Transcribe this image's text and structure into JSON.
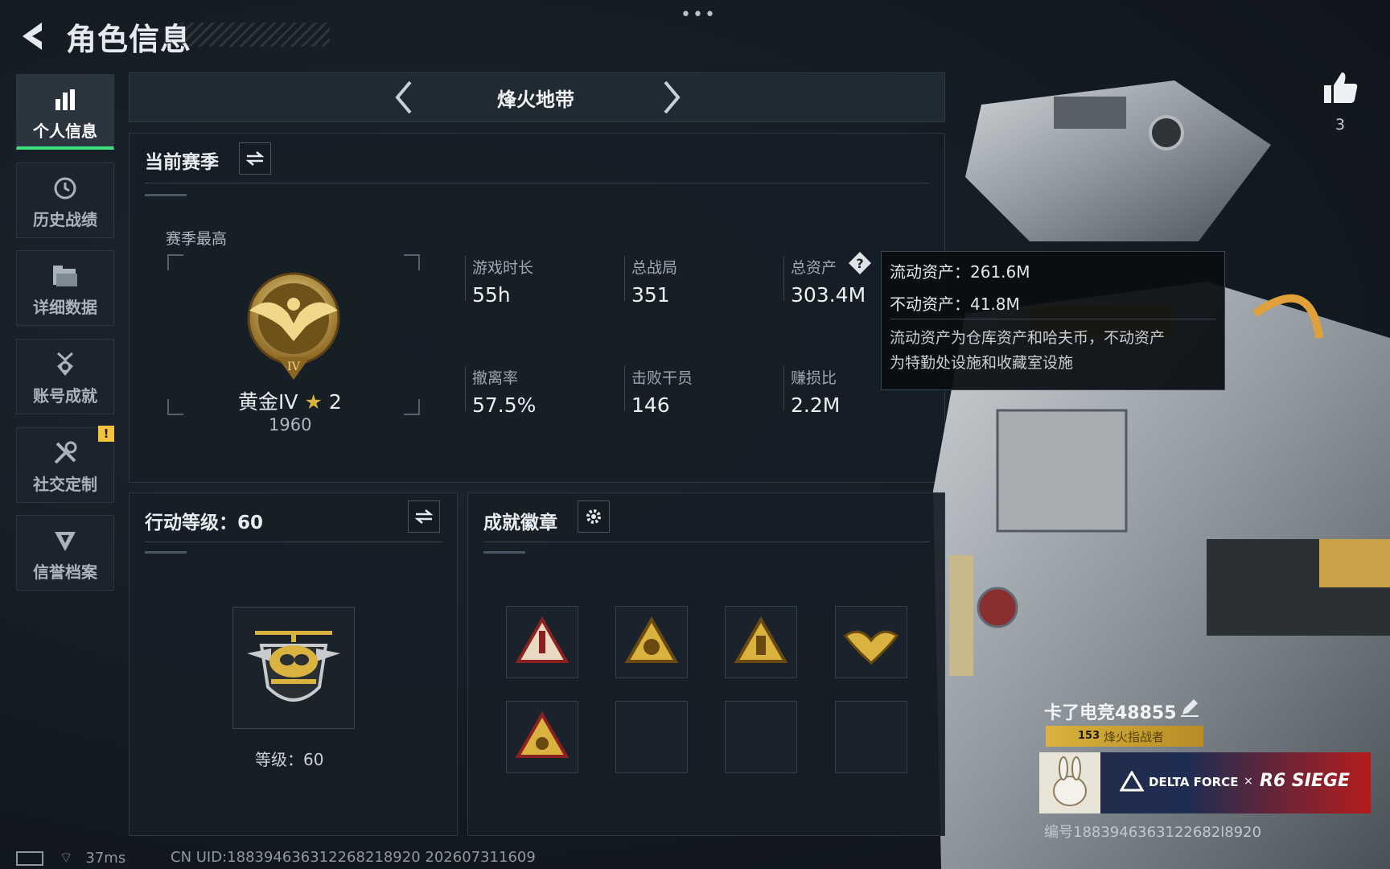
{
  "header": {
    "title": "角色信息",
    "more": "•••"
  },
  "sidebar": {
    "items": [
      {
        "label": "个人信息",
        "icon": "bar-chart-icon",
        "active": true
      },
      {
        "label": "历史战绩",
        "icon": "history-clock-icon",
        "active": false
      },
      {
        "label": "详细数据",
        "icon": "folder-icon",
        "active": false
      },
      {
        "label": "账号成就",
        "icon": "medal-icon",
        "active": false
      },
      {
        "label": "社交定制",
        "icon": "tools-icon",
        "active": false,
        "alert": "!"
      },
      {
        "label": "信誉档案",
        "icon": "shield-badge-icon",
        "active": false
      }
    ]
  },
  "mode": {
    "title": "烽火地带"
  },
  "season": {
    "title": "当前赛季",
    "best_label": "赛季最高",
    "rank_name": "黄金IV",
    "rank_stars": "2",
    "rank_score": "1960",
    "stats": [
      {
        "label": "游戏时长",
        "value": "55h"
      },
      {
        "label": "总战局",
        "value": "351"
      },
      {
        "label": "总资产",
        "value": "303.4M"
      },
      {
        "label": "撤离率",
        "value": "57.5%"
      },
      {
        "label": "击败干员",
        "value": "146"
      },
      {
        "label": "赚损比",
        "value": "2.2M"
      }
    ]
  },
  "tooltip": {
    "liquid": "流动资产：261.6M",
    "fixed": "不动资产：41.8M",
    "desc1": "流动资产为仓库资产和哈夫币，不动资产",
    "desc2": "为特勤处设施和收藏室设施"
  },
  "action_level": {
    "title": "行动等级：60",
    "level_text": "等级：60"
  },
  "achievements": {
    "title": "成就徽章",
    "badges_filled": 5,
    "slots": 8
  },
  "profile": {
    "likes": "3",
    "player_name": "卡了电竞48855",
    "level_num": "153",
    "level_title": "烽火指战者",
    "card_brand": "DELTA FORCE",
    "card_x": "×",
    "card_collab": "R6 SIEGE",
    "id_text": "编号1883946363122682l8920"
  },
  "status": {
    "ping": "37ms",
    "uid": "CN UID:188394636312268218920 202607311609"
  },
  "colors": {
    "accent_green": "#3fe07f",
    "gold": "#d9b23f",
    "panel": "#161e26"
  }
}
